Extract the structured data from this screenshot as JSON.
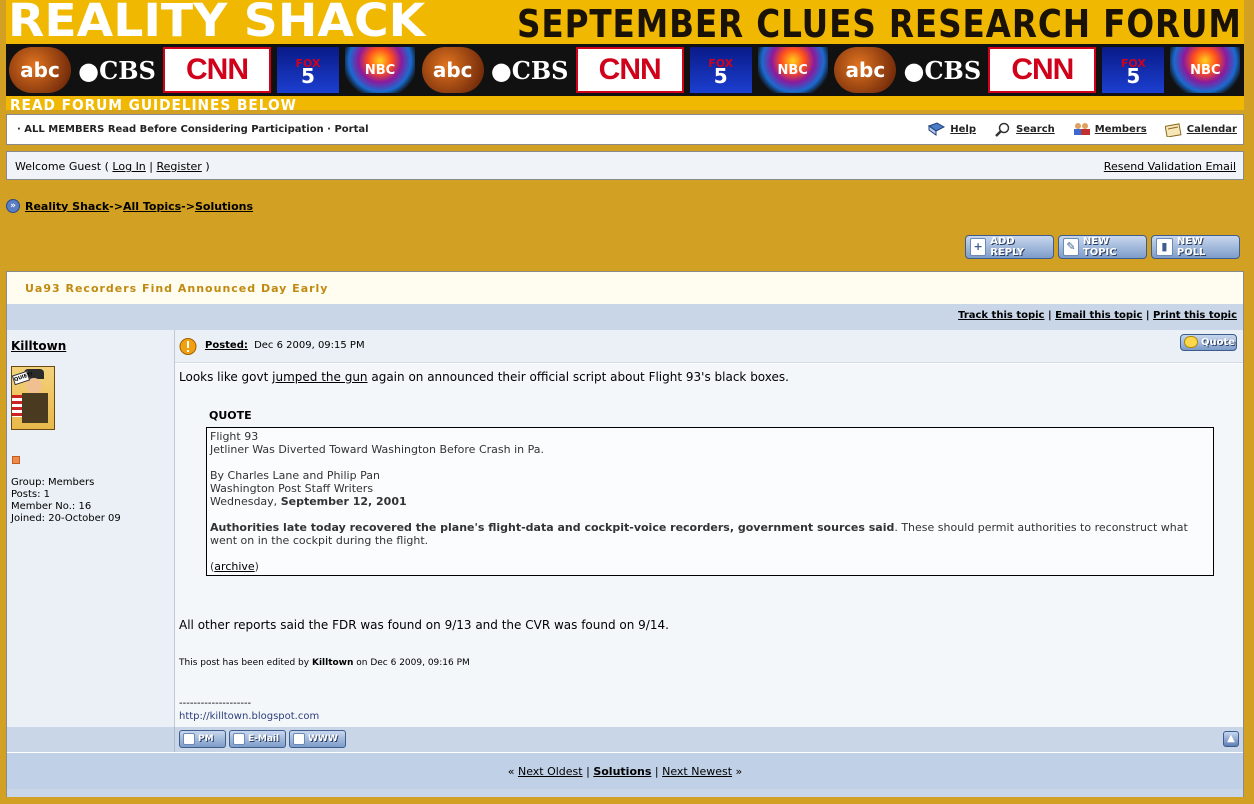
{
  "banner": {
    "site_title": "REALITY SHACK",
    "forum_title": "SEPTEMBER CLUES RESEARCH FORUM",
    "guidelines_text": "READ FORUM GUIDELINES BELOW",
    "logos": [
      "abc",
      "CBS",
      "CNN",
      "FOX NEWS",
      "NBC"
    ],
    "logo_fox_top": "FOX",
    "logo_fox_bottom": "5",
    "logo_nbc": "NBC"
  },
  "nav": {
    "left_text": "· ALL MEMBERS Read Before Considering Participation · Portal",
    "help": "Help",
    "search": "Search",
    "members": "Members",
    "calendar": "Calendar"
  },
  "userbar": {
    "welcome_prefix": "Welcome Guest (",
    "login": "Log In",
    "separator": "|",
    "register": "Register",
    "welcome_suffix": ")",
    "resend": "Resend Validation Email"
  },
  "breadcrumb": {
    "home": "Reality Shack",
    "sep1": "->",
    "all_topics": "All Topics",
    "sep2": "->",
    "current": "Solutions"
  },
  "actions": {
    "add_reply": "ADD REPLY",
    "new_topic": "NEW TOPIC",
    "new_poll": "NEW POLL"
  },
  "topic": {
    "title": "Ua93 Recorders Find Announced Day Early",
    "track": "Track this topic",
    "email": "Email this topic",
    "print": "Print this topic",
    "tool_sep": "|"
  },
  "author": {
    "name": "Killtown",
    "group": "Group: Members",
    "posts": "Posts: 1",
    "member_no": "Member No.: 16",
    "joined": "Joined: 20-October 09",
    "avatar_stamp": "QUIET!"
  },
  "post": {
    "posted_label": "Posted:",
    "posted_date": "Dec 6 2009, 09:15 PM",
    "quote_button": "Quote",
    "intro_before": "Looks like govt ",
    "intro_link": "jumped the gun",
    "intro_after": " again on announced their official script about Flight 93's black boxes.",
    "quote_label": "QUOTE",
    "quote_lines": {
      "l1": "Flight 93",
      "l2": "Jetliner Was Diverted Toward Washington Before Crash in Pa.",
      "l3": "By Charles Lane and Philip Pan",
      "l4": "Washington Post Staff Writers",
      "l5_prefix": "Wednesday, ",
      "l5_bold": "September 12, 2001",
      "l6_bold": "Authorities late today recovered the plane's flight-data and cockpit-voice recorders, government sources said",
      "l6_rest": ". These should permit authorities to reconstruct what went on in the cockpit during the flight.",
      "archive_open": "(",
      "archive_link": "archive",
      "archive_close": ")"
    },
    "outro": "All other reports said the FDR was found on 9/13 and the CVR was found on 9/14.",
    "edited_prefix": "This post has been edited by ",
    "edited_by": "Killtown",
    "edited_suffix": " on Dec 6 2009, 09:16 PM",
    "signature_rule": "--------------------",
    "signature_link": "http://killtown.blogspot.com"
  },
  "post_buttons": {
    "pm": "PM",
    "email": "E-Mail",
    "www": "WWW"
  },
  "topic_nav": {
    "left_quote": "«",
    "next_oldest": "Next Oldest",
    "sep": "|",
    "solutions": "Solutions",
    "next_newest": "Next Newest",
    "right_quote": "»"
  },
  "colors": {
    "page_bg": "#d2a022",
    "banner_bg": "#f0b800",
    "title_accent": "#c08a10",
    "table_header": "#c9d6e7"
  }
}
